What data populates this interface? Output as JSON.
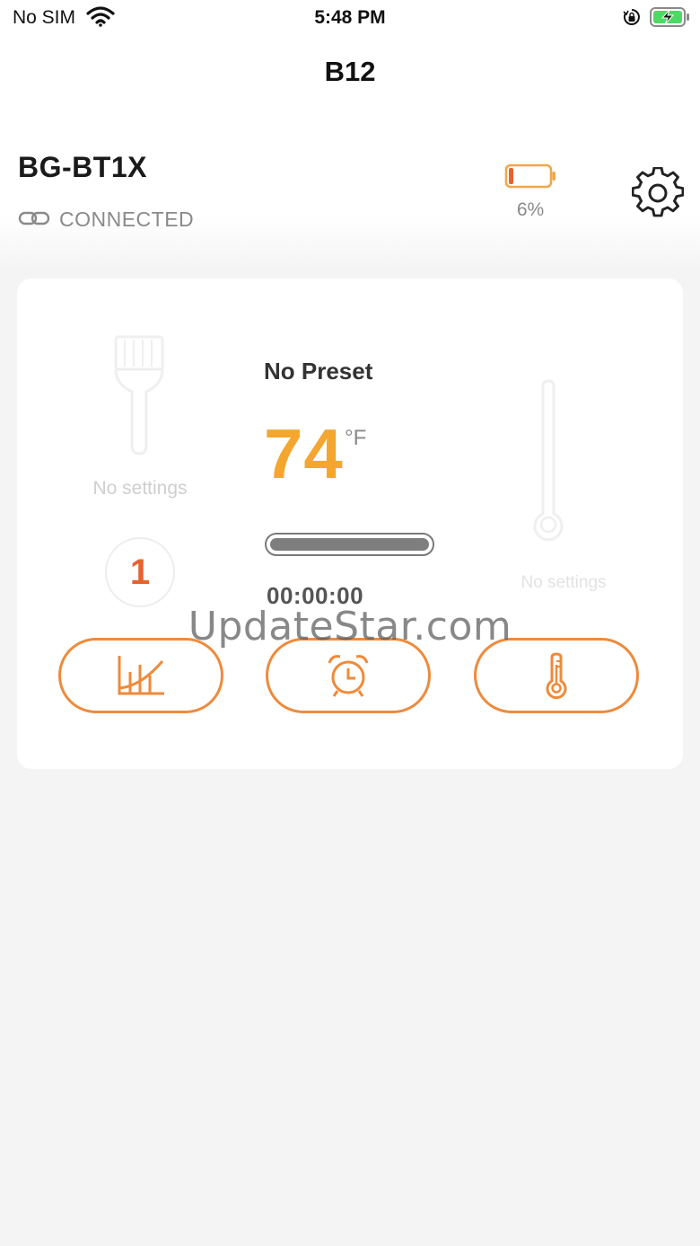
{
  "status_bar": {
    "carrier": "No SIM",
    "time": "5:48 PM",
    "icons": [
      "wifi-icon",
      "orientation-lock-icon",
      "battery-charging-icon"
    ]
  },
  "nav": {
    "title": "B12"
  },
  "device": {
    "name": "BG-BT1X",
    "connection_status": "CONNECTED",
    "battery_percent": "6%",
    "battery_level": 0.06
  },
  "probe_card": {
    "left_probe_status": "No settings",
    "preset_number": "1",
    "preset_name": "No Preset",
    "temperature": "74",
    "temperature_unit": "°F",
    "progress": 1.0,
    "timer": "00:00:00",
    "right_probe_status": "No settings",
    "buttons": [
      {
        "icon": "graph-chart-icon"
      },
      {
        "icon": "alarm-clock-icon"
      },
      {
        "icon": "thermometer-icon"
      }
    ]
  },
  "watermark": "UpdateStar.com",
  "colors": {
    "accent_orange": "#ef8a3a",
    "temperature_gold": "#f4a62e",
    "preset_red": "#e8622f",
    "battery_low": "#e8622f"
  }
}
